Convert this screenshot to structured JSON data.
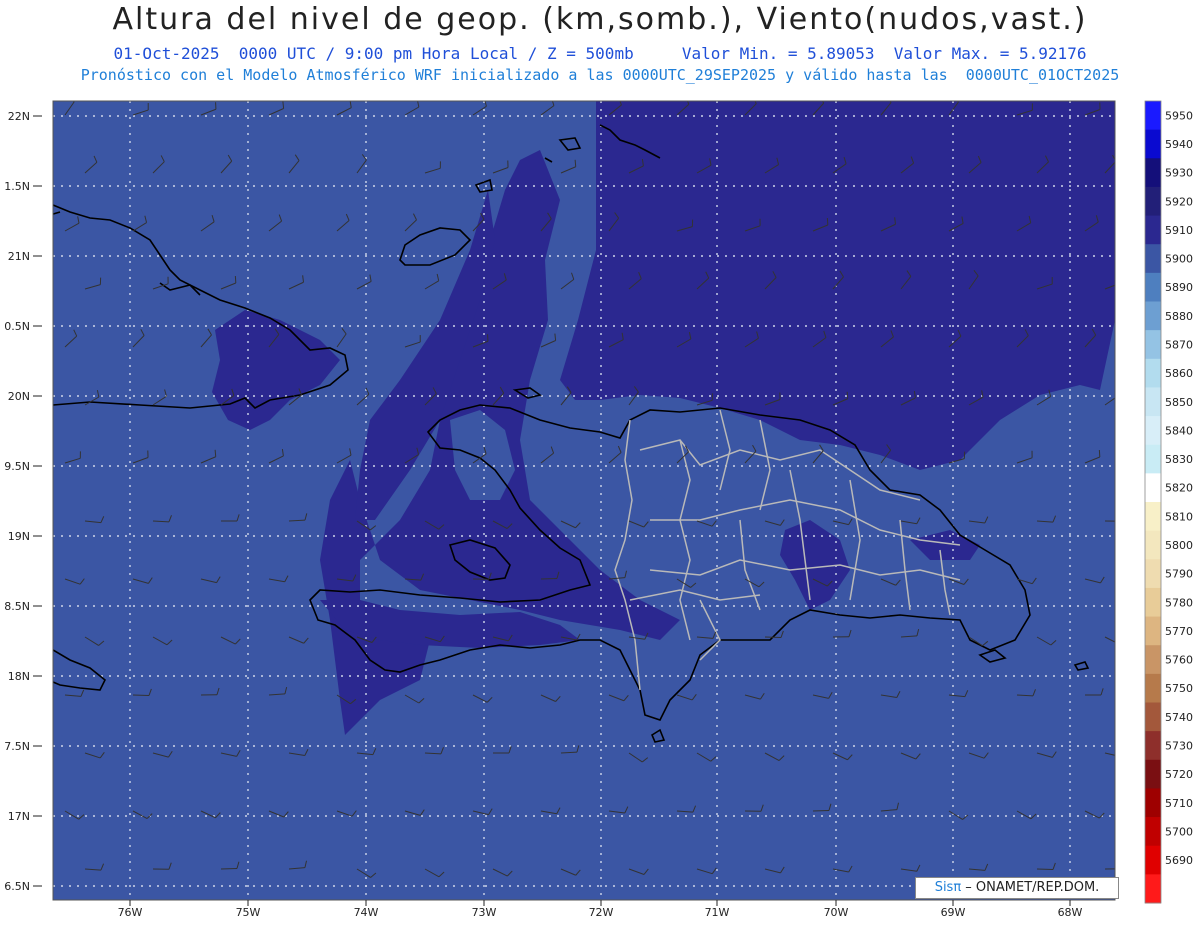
{
  "header": {
    "title": "Altura del nivel de geop. (km,somb.), Viento(nudos,vast.)",
    "subtitle_date": "01-Oct-2025  0000 UTC / 9:00 pm Hora Local / Z = 500mb",
    "subtitle_minmax": "Valor Min. = 5.89053  Valor Max. = 5.92176",
    "subtitle_model": "Pronóstico con el Modelo Atmosférico WRF inicializado a las 0000UTC_29SEP2025 y válido hasta las  0000UTC_01OCT2025"
  },
  "map": {
    "lat_labels": [
      "22N",
      "1.5N",
      "21N",
      "0.5N",
      "20N",
      "9.5N",
      "19N",
      "8.5N",
      "18N",
      "7.5N",
      "17N",
      "6.5N"
    ],
    "lon_labels": [
      "76W",
      "75W",
      "74W",
      "73W",
      "72W",
      "71W",
      "70W",
      "69W",
      "68W"
    ],
    "colors": {
      "base_fill": "#3b56a4",
      "high_fill": "#2b2890",
      "coast": "#000000",
      "province_border": "#b9b9b9"
    }
  },
  "colorbar": {
    "levels": [
      {
        "value": "5950",
        "color": "#1a1aff"
      },
      {
        "value": "5940",
        "color": "#0a0ad0"
      },
      {
        "value": "5930",
        "color": "#140f7a"
      },
      {
        "value": "5920",
        "color": "#221f78"
      },
      {
        "value": "5910",
        "color": "#2b2890"
      },
      {
        "value": "5900",
        "color": "#3b56a4"
      },
      {
        "value": "5890",
        "color": "#4e7fbf"
      },
      {
        "value": "5880",
        "color": "#6d9fd2"
      },
      {
        "value": "5870",
        "color": "#94c3e4"
      },
      {
        "value": "5860",
        "color": "#b2dcee"
      },
      {
        "value": "5850",
        "color": "#c8e6f3"
      },
      {
        "value": "5840",
        "color": "#d8eef8"
      },
      {
        "value": "5830",
        "color": "#c9ecf5"
      },
      {
        "value": "5820",
        "color": "#ffffff"
      },
      {
        "value": "5810",
        "color": "#f8f0c8"
      },
      {
        "value": "5800",
        "color": "#f3e7be"
      },
      {
        "value": "5790",
        "color": "#efdcb0"
      },
      {
        "value": "5780",
        "color": "#e8cc98"
      },
      {
        "value": "5770",
        "color": "#ddb581"
      },
      {
        "value": "5760",
        "color": "#c99566"
      },
      {
        "value": "5750",
        "color": "#b67a4b"
      },
      {
        "value": "5740",
        "color": "#a3583b"
      },
      {
        "value": "5730",
        "color": "#8e2f2b"
      },
      {
        "value": "5720",
        "color": "#7a0f12"
      },
      {
        "value": "5710",
        "color": "#9e0000"
      },
      {
        "value": "5700",
        "color": "#c00000"
      },
      {
        "value": "5690",
        "color": "#e00000"
      },
      {
        "value": "",
        "color": "#ff1a1a"
      }
    ]
  },
  "footer": {
    "credit_logo": "Sisπ",
    "credit_text": " – ONAMET/REP.DOM."
  }
}
